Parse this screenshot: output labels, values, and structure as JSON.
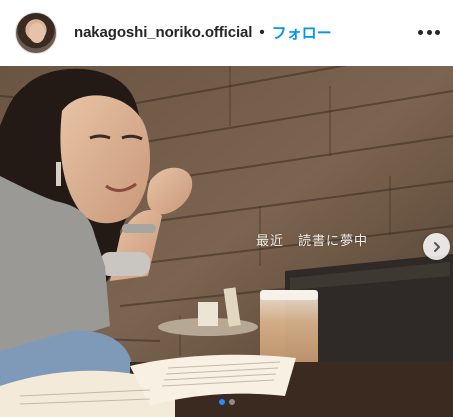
{
  "post": {
    "username": "nakagoshi_noriko.official",
    "separator": "•",
    "follow_label": "フォロー",
    "more_icon": "more-horizontal-icon",
    "next_icon": "chevron-right-icon"
  },
  "image": {
    "overlay_text": "最近　読書に夢中",
    "description_icon": "photo"
  },
  "carousel": {
    "slides_count": 2,
    "active_index": 0
  },
  "colors": {
    "follow_blue": "#0095f6",
    "text_dark": "#262626"
  }
}
